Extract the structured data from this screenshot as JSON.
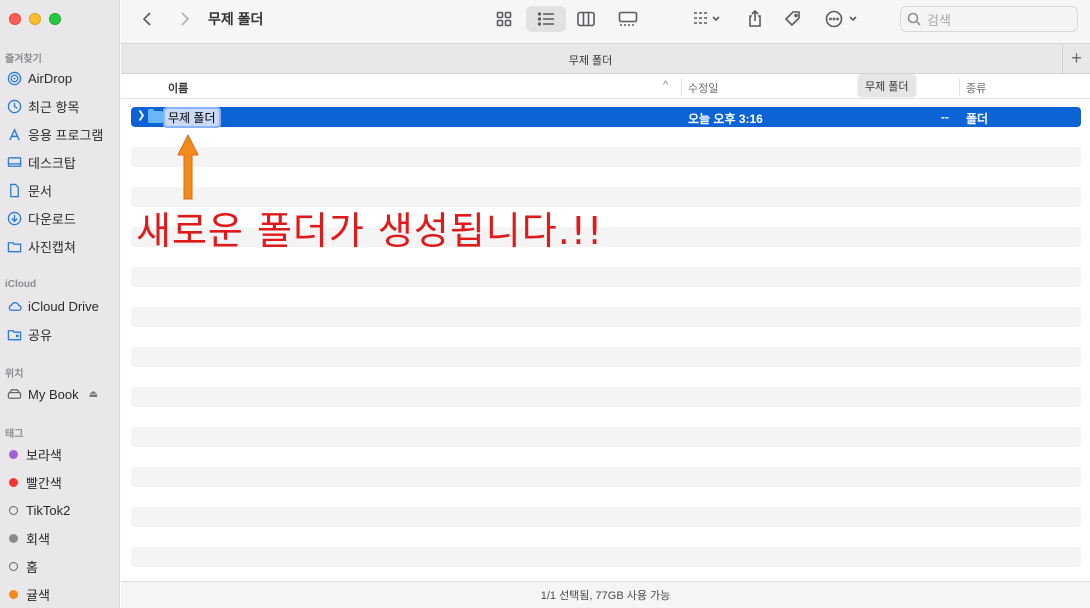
{
  "window": {
    "title": "무제 폴더",
    "tab_label": "무제 폴더",
    "tab_add": "+",
    "search_placeholder": "검색"
  },
  "sidebar": {
    "sections": {
      "favorites": "즐겨찾기",
      "icloud": "iCloud",
      "locations": "위치",
      "tags": "태그"
    },
    "favorites": [
      {
        "label": "AirDrop",
        "icon": "airdrop-icon"
      },
      {
        "label": "최근 항목",
        "icon": "clock-icon"
      },
      {
        "label": "응용 프로그램",
        "icon": "applications-icon"
      },
      {
        "label": "데스크탑",
        "icon": "desktop-icon"
      },
      {
        "label": "문서",
        "icon": "document-icon"
      },
      {
        "label": "다운로드",
        "icon": "download-icon"
      },
      {
        "label": "사진캡쳐",
        "icon": "folder-icon"
      }
    ],
    "icloud": [
      {
        "label": "iCloud Drive",
        "icon": "cloud-icon"
      },
      {
        "label": "공유",
        "icon": "shared-folder-icon"
      }
    ],
    "locations": [
      {
        "label": "My Book",
        "icon": "drive-icon",
        "eject": "⏏"
      }
    ],
    "tags": [
      {
        "label": "보라색",
        "color": "#a65fd6"
      },
      {
        "label": "빨간색",
        "color": "#f2352f"
      },
      {
        "label": "TikTok2",
        "color": "none"
      },
      {
        "label": "회색",
        "color": "#8a8a8d"
      },
      {
        "label": "홈",
        "color": "none"
      },
      {
        "label": "귤색",
        "color": "#f48a1c"
      }
    ]
  },
  "columns": {
    "name": "이름",
    "sort_indicator": "^",
    "modified": "수정일",
    "size_tooltip": "무제 폴더",
    "kind": "종류"
  },
  "rows": [
    {
      "name": "무제 폴더",
      "date": "오늘 오후 3:16",
      "size": "--",
      "kind": "폴더",
      "selected": true
    }
  ],
  "annotation": {
    "text": "새로운 폴더가 생성됩니다.!!",
    "color": "#e01a1a",
    "arrow_color": "#f28a1c"
  },
  "status": "1/1 선택됨, 77GB 사용 가능",
  "colors": {
    "selection": "#0b63d5",
    "sidebar_bg": "#e9e7ea"
  }
}
